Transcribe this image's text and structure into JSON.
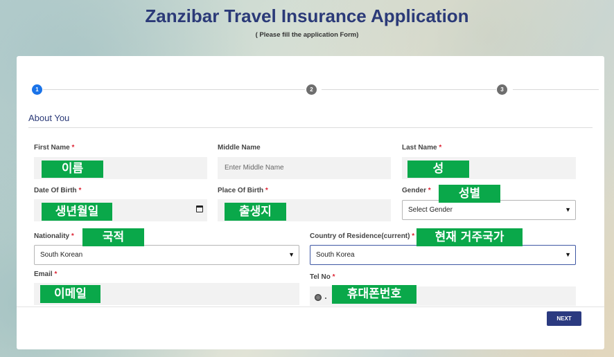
{
  "header": {
    "title": "Zanzibar Travel Insurance Application",
    "subtitle": "( Please fill the application Form)"
  },
  "stepper": {
    "steps": [
      {
        "number": "1",
        "state": "active"
      },
      {
        "number": "2",
        "state": "inactive"
      },
      {
        "number": "3",
        "state": "inactive"
      }
    ],
    "active_color": "#1a73e8",
    "inactive_color": "#6e6e6e"
  },
  "section": {
    "title": "About You"
  },
  "fields": {
    "first_name": {
      "label": "First Name",
      "required": "*",
      "annotation": "이름"
    },
    "middle_name": {
      "label": "Middle Name",
      "placeholder": "Enter Middle Name"
    },
    "last_name": {
      "label": "Last Name",
      "required": "*",
      "annotation": "성"
    },
    "date_of_birth": {
      "label": "Date Of Birth",
      "required": "*",
      "annotation": "생년월일"
    },
    "place_of_birth": {
      "label": "Place Of Birth",
      "required": "*",
      "annotation": "출생지"
    },
    "gender": {
      "label": "Gender",
      "required": "*",
      "value": "Select Gender",
      "annotation": "성별"
    },
    "nationality": {
      "label": "Nationality",
      "required": "*",
      "value": "South Korean",
      "annotation": "국적"
    },
    "country_of_residence": {
      "label": "Country of Residence(current)",
      "required": "*",
      "value": "South Korea",
      "annotation": "현재 거주국가"
    },
    "email": {
      "label": "Email",
      "required": "*",
      "annotation": "이메일"
    },
    "tel_no": {
      "label": "Tel No",
      "required": "*",
      "annotation": "휴대폰번호"
    }
  },
  "actions": {
    "next_label": "NEXT"
  },
  "colors": {
    "brand": "#2b3a78",
    "button": "#2b3a80",
    "annotation_green": "#0aa84a",
    "required_red": "#d23"
  }
}
